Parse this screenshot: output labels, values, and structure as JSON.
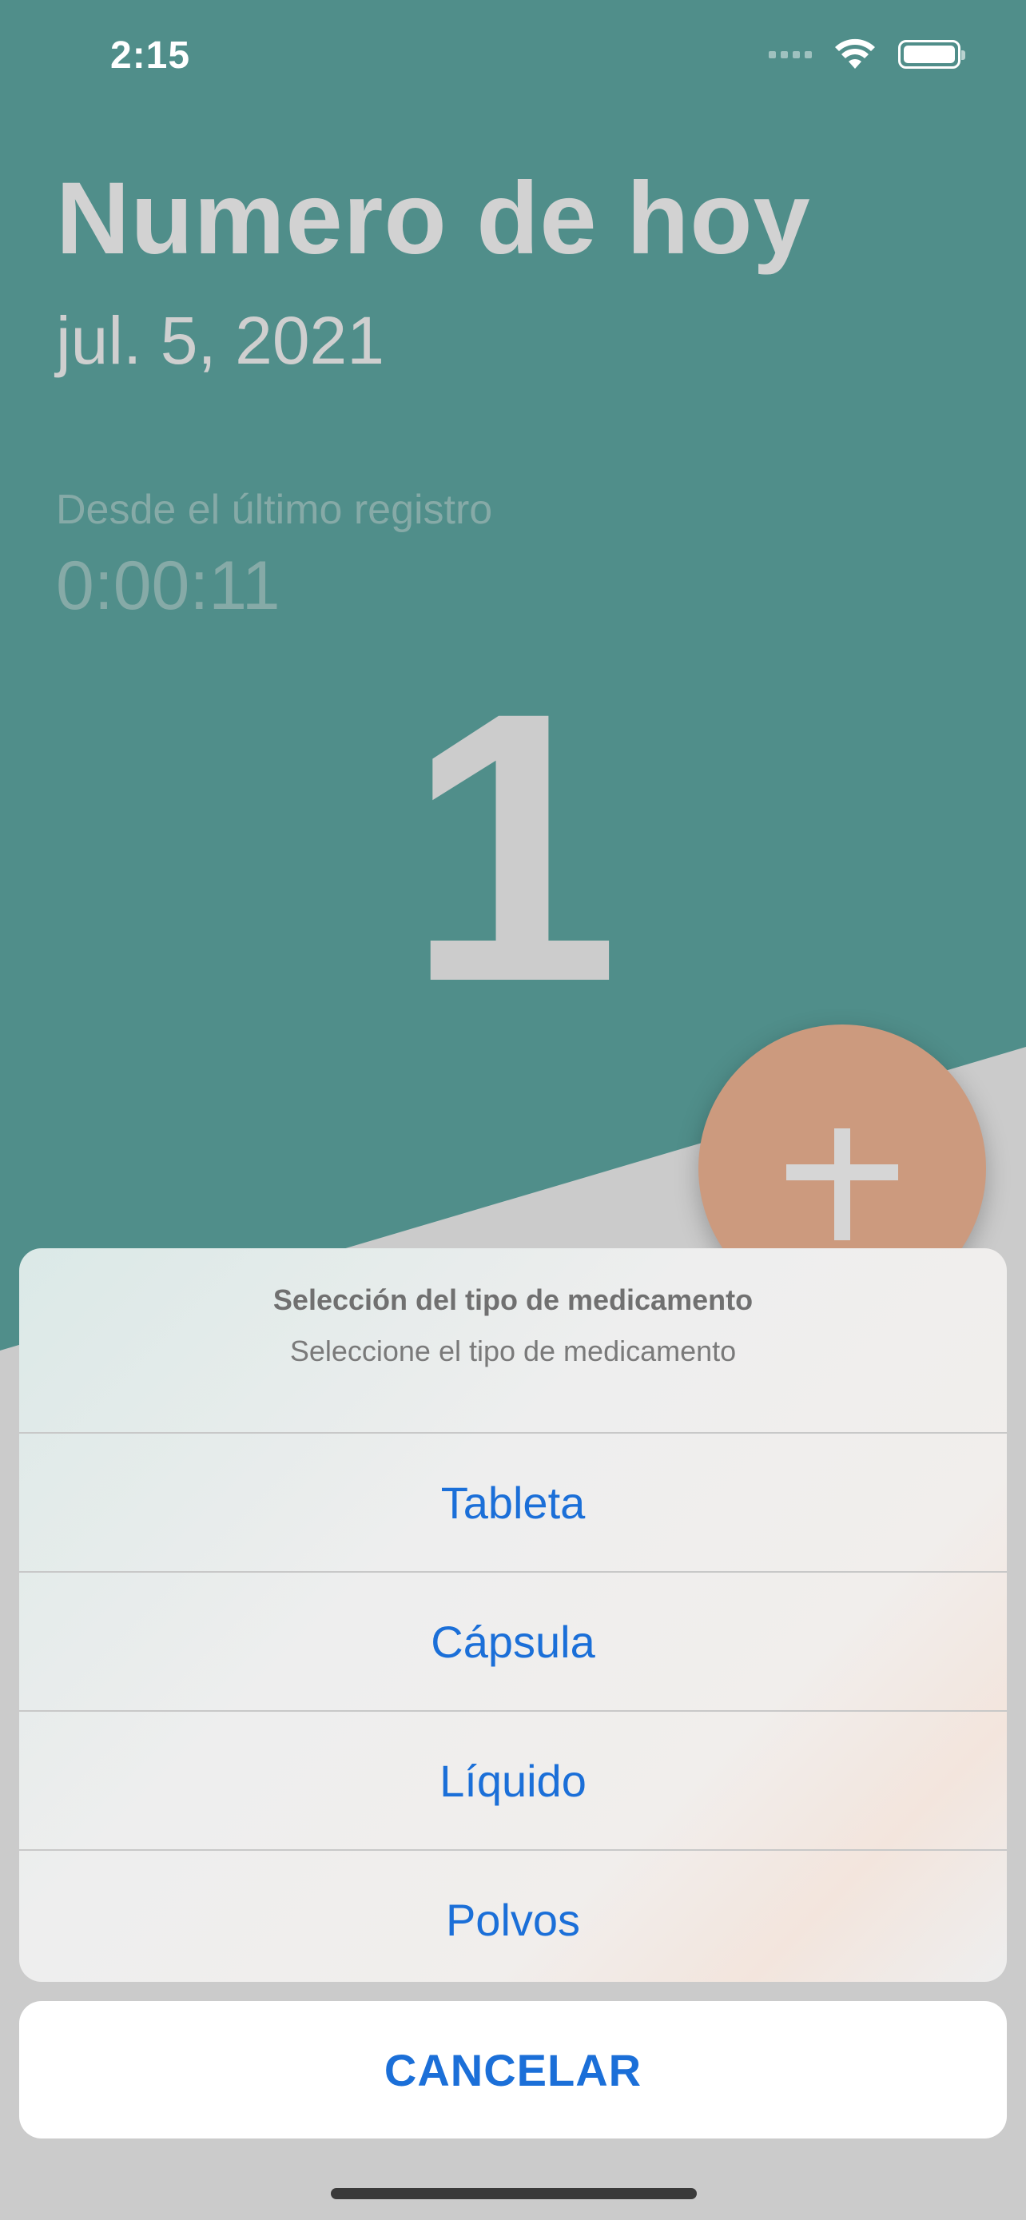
{
  "status_bar": {
    "time": "2:15",
    "icons": [
      "signal-icon",
      "wifi-icon",
      "battery-icon"
    ]
  },
  "header": {
    "title": "Numero de hoy",
    "date": "jul. 5, 2021"
  },
  "since_last": {
    "label": "Desde el último registro",
    "value": "0:00:11"
  },
  "count": "1",
  "fab": {
    "icon": "plus-icon"
  },
  "action_sheet": {
    "title": "Selección del tipo de medicamento",
    "subtitle": "Seleccione el tipo de medicamento",
    "options": [
      "Tableta",
      "Cápsula",
      "Líquido",
      "Polvos"
    ],
    "cancel_label": "CANCELAR"
  },
  "colors": {
    "background_teal": "#508e8a",
    "fab_orange": "#cc9a7e",
    "action_blue": "#1b6fd8",
    "text_light": "#d2d2d2"
  }
}
